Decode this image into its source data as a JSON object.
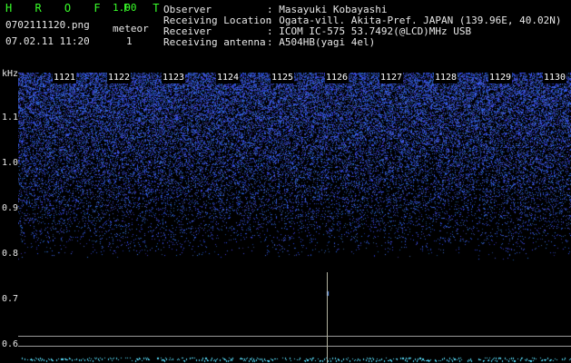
{
  "header": {
    "logo": "H R O F F T",
    "version": "1.00",
    "filename": "0702111120.png",
    "datetime": "07.02.11 11:20",
    "meteor_label": "meteor",
    "meteor_count": "1"
  },
  "info": {
    "labels": [
      "Observer",
      "Receiving Location",
      "Receiver",
      "Receiving antenna"
    ],
    "values": [
      ": Masayuki Kobayashi",
      ": Ogata-vill. Akita-Pref. JAPAN (139.96E, 40.02N)",
      ": ICOM IC-575 53.7492(@LCD)MHz USB",
      ": A504HB(yagi 4el)"
    ]
  },
  "axis": {
    "y_unit": "kHz",
    "y_ticks": [
      "1.1",
      "1.0",
      "0.9",
      "0.8",
      "0.7",
      "0.6"
    ],
    "x_ticks": [
      "1121",
      "1122",
      "1123",
      "1124",
      "1125",
      "1126",
      "1127",
      "1128",
      "1129",
      "1130"
    ]
  },
  "colors": {
    "background": "#000000",
    "header_green": "#39ff2a",
    "noise_blue": "#2a3cff",
    "signal_cyan": "#59e0ff"
  }
}
